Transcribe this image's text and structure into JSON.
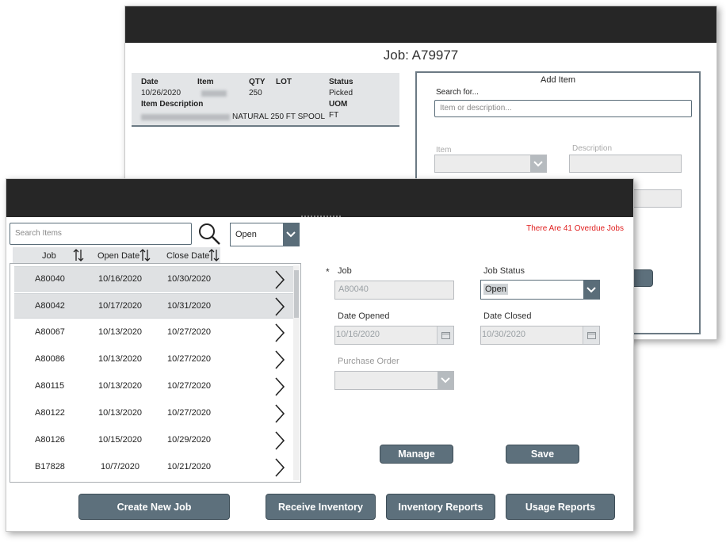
{
  "back_window": {
    "title": "Job: A79977",
    "item_card": {
      "headers": {
        "date": "Date",
        "item": "Item",
        "qty": "QTY",
        "lot": "LOT",
        "status": "Status",
        "item_description": "Item Description",
        "uom": "UOM"
      },
      "values": {
        "date": "10/26/2020",
        "qty": "250",
        "status": "Picked",
        "description_suffix": "NATURAL 250 FT SPOOL",
        "uom": "FT"
      }
    },
    "add_item": {
      "title": "Add Item",
      "search_label": "Search for...",
      "search_placeholder": "Item or description...",
      "item_label": "Item",
      "description_label": "Description"
    }
  },
  "front_window": {
    "search_placeholder": "Search Items",
    "status_filter": "Open",
    "overdue_text": "There Are 41 Overdue Jobs",
    "columns": [
      "Job",
      "Open Date",
      "Close Date"
    ],
    "rows": [
      {
        "job": "A80040",
        "open": "10/16/2020",
        "close": "10/30/2020"
      },
      {
        "job": "A80042",
        "open": "10/17/2020",
        "close": "10/31/2020"
      },
      {
        "job": "A80067",
        "open": "10/13/2020",
        "close": "10/27/2020"
      },
      {
        "job": "A80086",
        "open": "10/13/2020",
        "close": "10/27/2020"
      },
      {
        "job": "A80115",
        "open": "10/13/2020",
        "close": "10/27/2020"
      },
      {
        "job": "A80122",
        "open": "10/13/2020",
        "close": "10/27/2020"
      },
      {
        "job": "A80126",
        "open": "10/15/2020",
        "close": "10/29/2020"
      },
      {
        "job": "B17828",
        "open": "10/7/2020",
        "close": "10/21/2020"
      }
    ],
    "form": {
      "required_mark": "*",
      "job_label": "Job",
      "job_value": "A80040",
      "job_status_label": "Job Status",
      "job_status_value": "Open",
      "date_opened_label": "Date Opened",
      "date_opened_value": "10/16/2020",
      "date_closed_label": "Date Closed",
      "date_closed_value": "10/30/2020",
      "purchase_order_label": "Purchase Order"
    },
    "buttons": {
      "manage": "Manage",
      "save": "Save",
      "create_new_job": "Create New Job",
      "receive_inventory": "Receive Inventory",
      "inventory_reports": "Inventory Reports",
      "usage_reports": "Usage Reports"
    }
  },
  "colors": {
    "titlebar": "#262626",
    "button": "#5d707c",
    "overdue": "#e02020",
    "accent_border": "#5a6d79"
  }
}
